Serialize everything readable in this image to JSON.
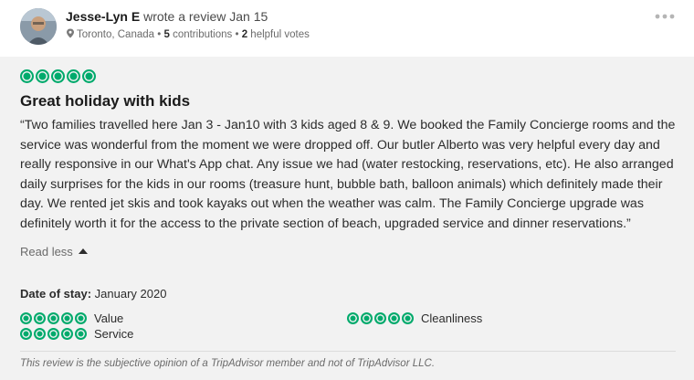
{
  "review": {
    "author_name": "Jesse-Lyn E",
    "author_action": " wrote a review Jan 15",
    "location": "Toronto, Canada",
    "separator": " • ",
    "contributions_count": "5",
    "contributions_label": " contributions",
    "helpful_count": "2",
    "helpful_label": " helpful votes",
    "bubble_rating": 5,
    "title": "Great holiday with kids",
    "body": "“Two families travelled here Jan 3 - Jan10 with 3 kids aged 8 & 9. We booked the Family Concierge rooms and the service was wonderful from the moment we were dropped off. Our butler Alberto was very helpful every day and really responsive in our What's App chat. Any issue we had (water restocking, reservations, etc). He also arranged daily surprises for the kids in our rooms (treasure hunt, bubble bath, balloon animals) which definitely made their day. We rented jet skis and took kayaks out when the weather was calm. The Family Concierge upgrade was definitely worth it for the access to the private section of beach, upgraded service and dinner reservations.”",
    "read_less_label": "Read less",
    "date_of_stay_label": "Date of stay:",
    "date_of_stay_value": " January 2020",
    "subratings": [
      {
        "label": "Value",
        "rating": 5
      },
      {
        "label": "Cleanliness",
        "rating": 5
      },
      {
        "label": "Service",
        "rating": 5
      }
    ],
    "disclaimer": "This review is the subjective opinion of a TripAdvisor member and not of TripAdvisor LLC."
  },
  "colors": {
    "bubble_green": "#00aa6c",
    "background": "#f2f2f2"
  },
  "icons": [
    "avatar",
    "map-pin-icon",
    "more-options-icon",
    "rating-bubble-icon",
    "caret-up-icon"
  ]
}
